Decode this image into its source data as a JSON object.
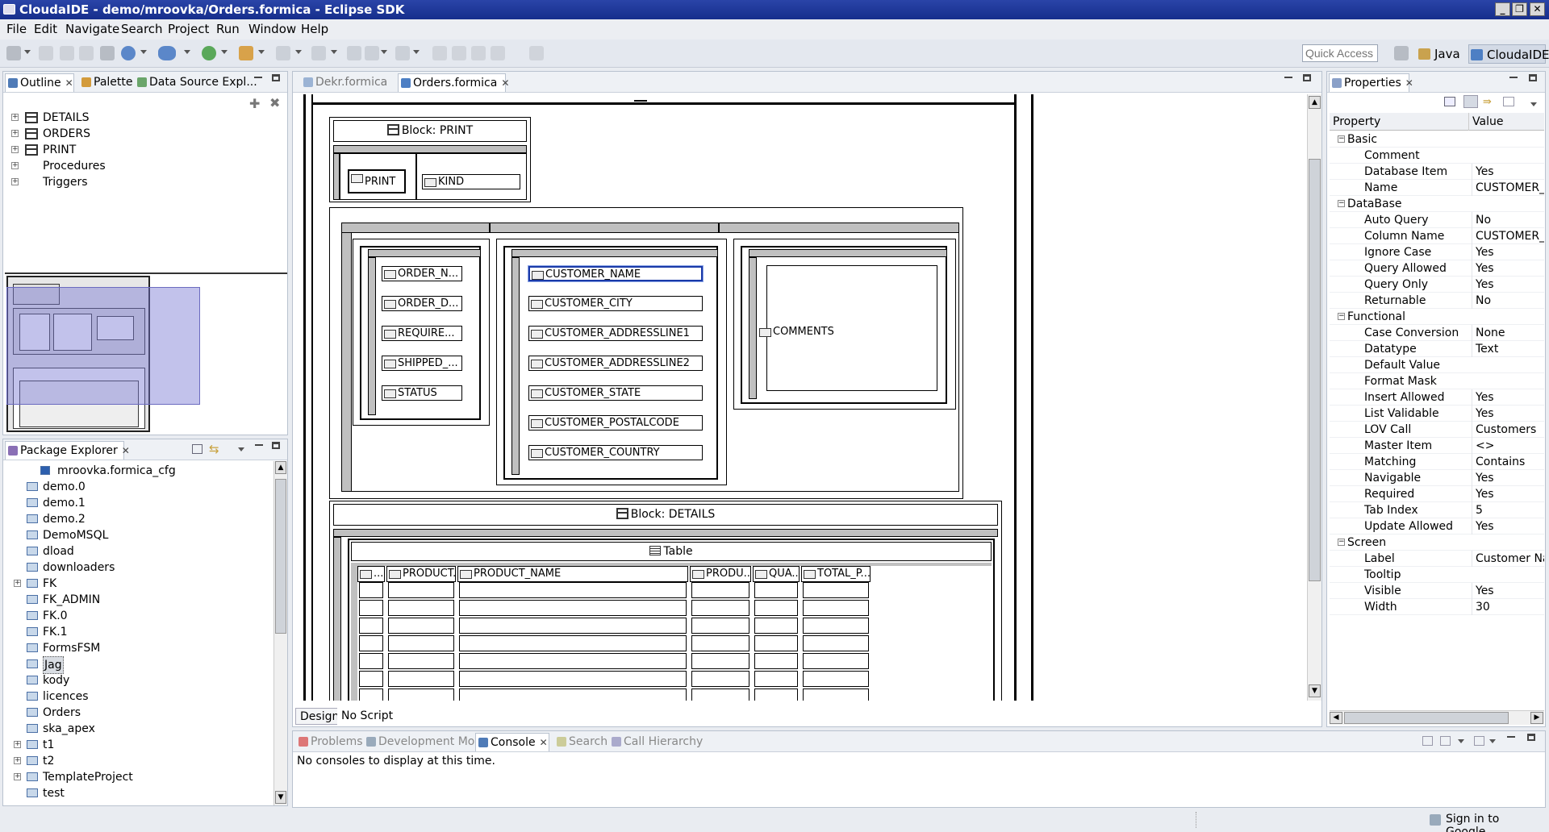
{
  "window": {
    "title": "CloudaIDE - demo/mroovka/Orders.formica - Eclipse SDK"
  },
  "menu": [
    "File",
    "Edit",
    "Navigate",
    "Search",
    "Project",
    "Run",
    "Window",
    "Help"
  ],
  "toolbar": {
    "quick_access_placeholder": "Quick Access"
  },
  "perspectives": [
    {
      "label": "Java"
    },
    {
      "label": "CloudaIDE"
    }
  ],
  "outline_panel": {
    "tabs": [
      "Outline",
      "Palette",
      "Data Source Expl..."
    ],
    "items": [
      {
        "label": "DETAILS",
        "icon": "block-icon"
      },
      {
        "label": "ORDERS",
        "icon": "block-icon"
      },
      {
        "label": "PRINT",
        "icon": "block-icon"
      },
      {
        "label": "Procedures",
        "icon": ""
      },
      {
        "label": "Triggers",
        "icon": ""
      }
    ]
  },
  "package_explorer": {
    "tab": "Package Explorer",
    "items": [
      {
        "label": "mroovka.formica_cfg",
        "kind": "file",
        "indent": 1
      },
      {
        "label": "demo.0",
        "kind": "project"
      },
      {
        "label": "demo.1",
        "kind": "project"
      },
      {
        "label": "demo.2",
        "kind": "project"
      },
      {
        "label": "DemoMSQL",
        "kind": "project"
      },
      {
        "label": "dload",
        "kind": "project"
      },
      {
        "label": "downloaders",
        "kind": "project"
      },
      {
        "label": "FK",
        "kind": "project-open"
      },
      {
        "label": "FK_ADMIN",
        "kind": "project"
      },
      {
        "label": "FK.0",
        "kind": "project"
      },
      {
        "label": "FK.1",
        "kind": "project"
      },
      {
        "label": "FormsFSM",
        "kind": "project"
      },
      {
        "label": "Jag",
        "kind": "project",
        "selected": true
      },
      {
        "label": "kody",
        "kind": "project"
      },
      {
        "label": "licences",
        "kind": "project"
      },
      {
        "label": "Orders",
        "kind": "project"
      },
      {
        "label": "ska_apex",
        "kind": "project"
      },
      {
        "label": "t1",
        "kind": "project-open"
      },
      {
        "label": "t2",
        "kind": "project-open"
      },
      {
        "label": "TemplateProject",
        "kind": "project-open"
      },
      {
        "label": "test",
        "kind": "project"
      }
    ]
  },
  "editor": {
    "tabs": [
      {
        "label": "Dekr.formica",
        "active": false
      },
      {
        "label": "Orders.formica",
        "active": true
      }
    ],
    "bottom_tabs": [
      "Design",
      "No Script"
    ],
    "print_block": {
      "title": "Block: PRINT",
      "fields": [
        "PRINT",
        "KIND"
      ]
    },
    "orders_fields_col1": [
      "ORDER_N...",
      "ORDER_D...",
      "REQUIRE...",
      "SHIPPED_...",
      "STATUS"
    ],
    "orders_fields_col2": [
      "CUSTOMER_NAME",
      "CUSTOMER_CITY",
      "CUSTOMER_ADDRESSLINE1",
      "CUSTOMER_ADDRESSLINE2",
      "CUSTOMER_STATE",
      "CUSTOMER_POSTALCODE",
      "CUSTOMER_COUNTRY"
    ],
    "comments_field": "COMMENTS",
    "details_block": {
      "title": "Block: DETAILS",
      "table_title": "Table",
      "columns": [
        "...",
        "PRODUCT...",
        "PRODUCT_NAME",
        "PRODU...",
        "QUA...",
        "TOTAL_P..."
      ]
    }
  },
  "properties": {
    "tab": "Properties",
    "header": {
      "property": "Property",
      "value": "Value"
    },
    "rows": [
      {
        "name": "Basic",
        "value": "",
        "category": true
      },
      {
        "name": "Comment",
        "value": ""
      },
      {
        "name": "Database Item",
        "value": "Yes"
      },
      {
        "name": "Name",
        "value": "CUSTOMER_N"
      },
      {
        "name": "DataBase",
        "value": "",
        "category": true
      },
      {
        "name": "Auto Query",
        "value": "No"
      },
      {
        "name": "Column Name",
        "value": "CUSTOMER_N"
      },
      {
        "name": "Ignore Case",
        "value": "Yes"
      },
      {
        "name": "Query Allowed",
        "value": "Yes"
      },
      {
        "name": "Query Only",
        "value": "Yes"
      },
      {
        "name": "Returnable",
        "value": "No"
      },
      {
        "name": "Functional",
        "value": "",
        "category": true
      },
      {
        "name": "Case Conversion",
        "value": "None"
      },
      {
        "name": "Datatype",
        "value": "Text"
      },
      {
        "name": "Default Value",
        "value": ""
      },
      {
        "name": "Format Mask",
        "value": ""
      },
      {
        "name": "Insert Allowed",
        "value": "Yes"
      },
      {
        "name": "List Validable",
        "value": "Yes"
      },
      {
        "name": "LOV Call",
        "value": "Customers"
      },
      {
        "name": "Master Item",
        "value": "<>"
      },
      {
        "name": "Matching",
        "value": "Contains"
      },
      {
        "name": "Navigable",
        "value": "Yes"
      },
      {
        "name": "Required",
        "value": "Yes"
      },
      {
        "name": "Tab Index",
        "value": "5"
      },
      {
        "name": "Update Allowed",
        "value": "Yes"
      },
      {
        "name": "Screen",
        "value": "",
        "category": true
      },
      {
        "name": "Label",
        "value": "Customer Nam"
      },
      {
        "name": "Tooltip",
        "value": ""
      },
      {
        "name": "Visible",
        "value": "Yes"
      },
      {
        "name": "Width",
        "value": "30"
      }
    ]
  },
  "console_panel": {
    "tabs": [
      "Problems",
      "Development Mode",
      "Console",
      "Search",
      "Call Hierarchy"
    ],
    "message": "No consoles to display at this time."
  },
  "status": {
    "sign_in": "Sign in to Google..."
  }
}
